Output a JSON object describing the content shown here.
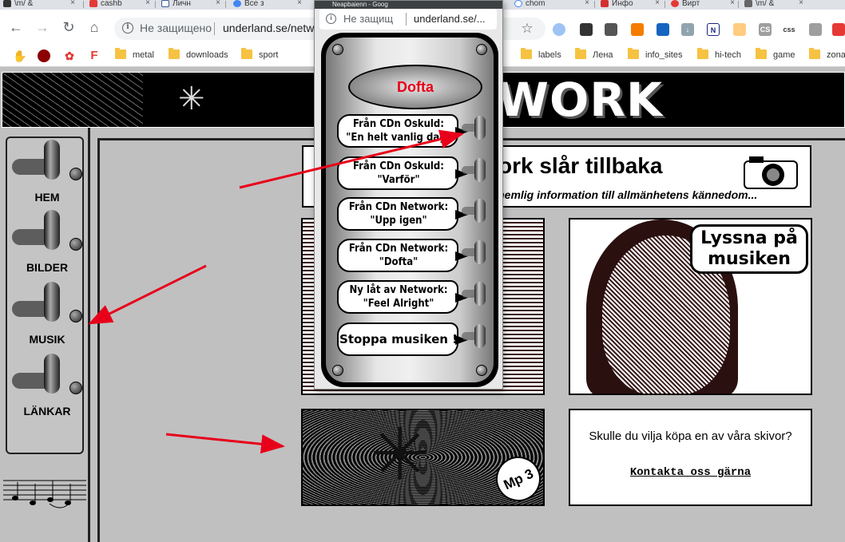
{
  "browser": {
    "tabs": [
      "\\m/ &",
      "cashb",
      "Личн",
      "Все з",
      "",
      "chom",
      "Инфо",
      "Вирт",
      "\\m/ &"
    ],
    "address": {
      "security_label": "Не защищено",
      "url": "underland.se/netw"
    },
    "extension_labels": [
      "N",
      "CS",
      "css"
    ],
    "bookmarks": [
      "metal",
      "downloads",
      "sport",
      "labels",
      "Лена",
      "info_sites",
      "hi-tech",
      "game",
      "zona"
    ]
  },
  "popup": {
    "title": "Neapbaienn - Goog",
    "security_label": "Не защищ",
    "url": "underland.se/..."
  },
  "player": {
    "now_playing": "Dofta",
    "songs": [
      {
        "line1": "Från CDn Oskuld:",
        "line2": "\"En helt vanlig dag\""
      },
      {
        "line1": "Från CDn Oskuld:",
        "line2": "\"Varför\""
      },
      {
        "line1": "Från CDn Network:",
        "line2": "\"Upp igen\""
      },
      {
        "line1": "Från CDn Network:",
        "line2": "\"Dofta\""
      },
      {
        "line1": "Ny låt av Network:",
        "line2": "\"Feel Alright\""
      }
    ],
    "stop_label": "Stoppa musiken !"
  },
  "site": {
    "logo": "WORK",
    "nav": [
      "HEM",
      "BILDER",
      "MUSIK",
      "LÄNKAR"
    ],
    "banner_title": "ork slår tillbaka",
    "banner_sub": "ut  hemlig information till allmänhetens kännedom...",
    "bubble_text": "Lyssna på musiken",
    "mp3_label": "Mp 3",
    "buy_question": "Skulle du vilja köpa en av våra skivor?",
    "contact_link": "Kontakta oss gärna"
  },
  "colors": {
    "arrow": "#e8001a",
    "now_playing_text": "#e8001a"
  }
}
